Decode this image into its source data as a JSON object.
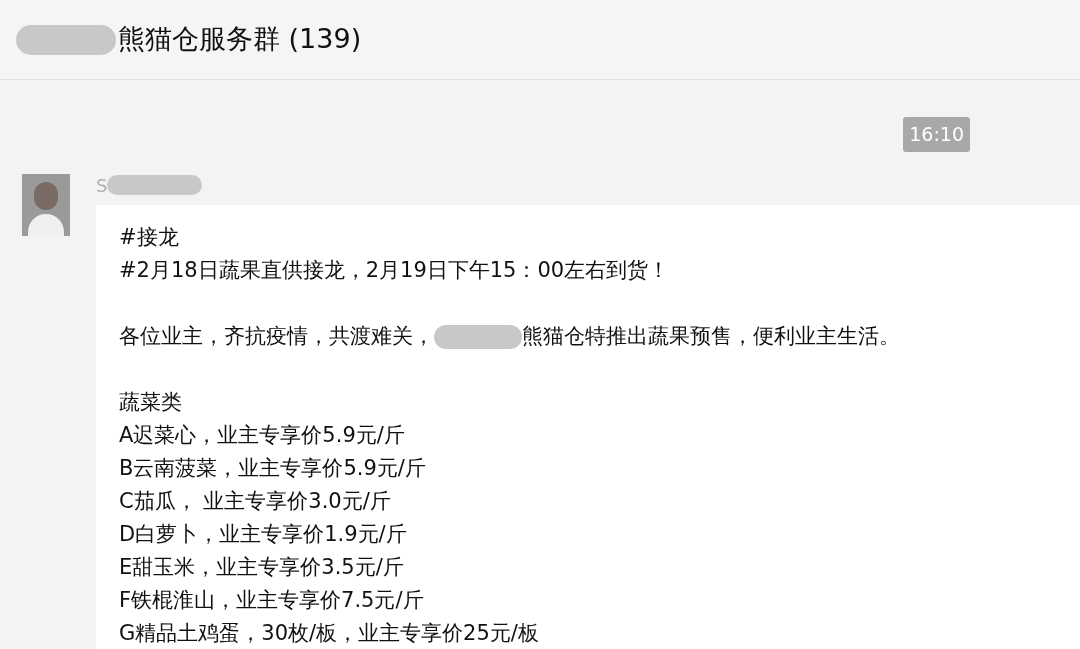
{
  "window": {
    "title": "熊猫仓服务群 (139)"
  },
  "timestamp": "16:10",
  "message": {
    "sender": "S",
    "lines": [
      {
        "kind": "text",
        "text": "#接龙"
      },
      {
        "kind": "text",
        "text": "#2月18日蔬果直供接龙，2月19日下午15：00左右到货！"
      },
      {
        "kind": "blank"
      },
      {
        "kind": "redacted",
        "before": "各位业主，齐抗疫情，共渡难关，",
        "after": "熊猫仓特推出蔬果预售，便利业主生活。"
      },
      {
        "kind": "blank"
      },
      {
        "kind": "text",
        "text": "蔬菜类"
      },
      {
        "kind": "text",
        "text": "A迟菜心，业主专享价5.9元/斤"
      },
      {
        "kind": "text",
        "text": "B云南菠菜，业主专享价5.9元/斤"
      },
      {
        "kind": "text",
        "text": "C茄瓜， 业主专享价3.0元/斤"
      },
      {
        "kind": "text",
        "text": "D白萝卜，业主专享价1.9元/斤"
      },
      {
        "kind": "text",
        "text": "E甜玉米，业主专享价3.5元/斤"
      },
      {
        "kind": "text",
        "text": "F铁棍淮山，业主专享价7.5元/斤"
      },
      {
        "kind": "text",
        "text": "G精品土鸡蛋，30枚/板，业主专享价25元/板"
      }
    ]
  }
}
